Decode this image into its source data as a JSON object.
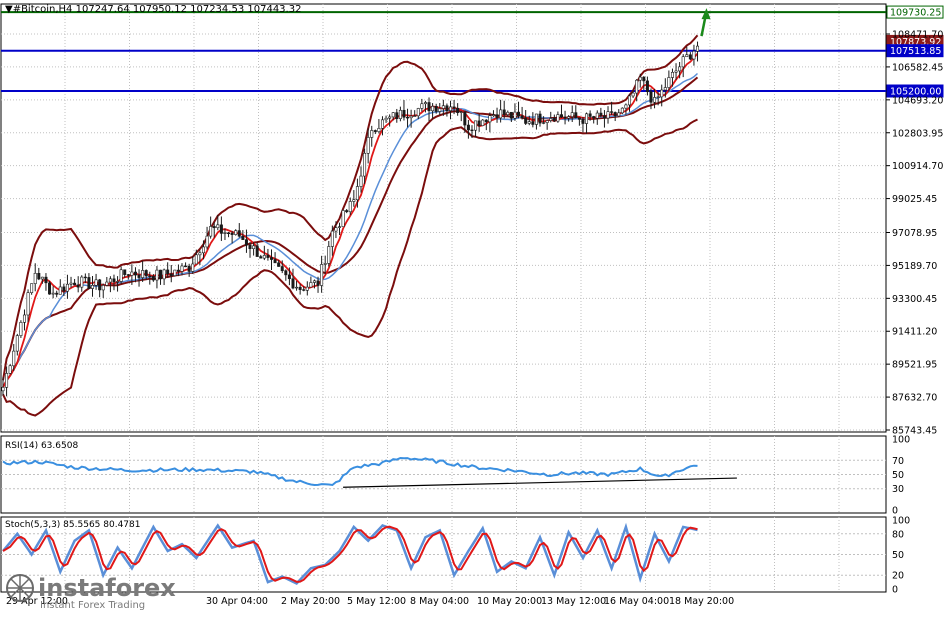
{
  "header": {
    "symbol_line": "▼#Bitcoin,H4  107247.64 107950.12 107234.53 107443.32"
  },
  "colors": {
    "background": "#ffffff",
    "grid": "#c0c0c0",
    "bull_candle": "#1a1a1a",
    "bear_candle": "#1a1a1a",
    "bollinger": "#7b0d0d",
    "ma_fast": "#e01818",
    "ma_slow": "#5a8fd8",
    "level_blue": "#0000c8",
    "level_green": "#006400",
    "rsi_line": "#3a8fe0",
    "stoch_main": "#5a8fd8",
    "stoch_signal": "#e01818",
    "forecast_arrow": "#1a8a1a",
    "trendline": "#000000"
  },
  "watermark": {
    "brand": "instaforex",
    "tagline": "Instant Forex Trading"
  },
  "chart_data": [
    {
      "type": "candlestick",
      "title": "#Bitcoin,H4",
      "ylim": [
        85743.45,
        110800
      ],
      "price_ticks": [
        "108471.70",
        "106582.45",
        "104693.20",
        "102803.95",
        "100914.70",
        "99025.45",
        "97078.95",
        "95189.70",
        "93300.45",
        "91411.20",
        "89521.95",
        "87632.70",
        "85743.45"
      ],
      "time_labels": [
        "29 Apr 12:00",
        "30 Apr 04:00",
        "2 May 20:00",
        "5 May 12:00",
        "8 May 04:00",
        "10 May 20:00",
        "13 May 12:00",
        "16 May 04:00",
        "18 May 20:00"
      ],
      "levels": [
        {
          "label": "109730.25",
          "value": 109730.25,
          "color": "green"
        },
        {
          "label": "107873.92",
          "value": 107873.92,
          "color": "current"
        },
        {
          "label": "107513.85",
          "value": 107513.85,
          "color": "blue"
        },
        {
          "label": "105200.00",
          "value": 105200.0,
          "color": "blue"
        }
      ],
      "anchors": [
        {
          "t": 0,
          "p": 88200
        },
        {
          "t": 4,
          "p": 91200
        },
        {
          "t": 9,
          "p": 94800
        },
        {
          "t": 14,
          "p": 93600
        },
        {
          "t": 20,
          "p": 94300
        },
        {
          "t": 27,
          "p": 94000
        },
        {
          "t": 35,
          "p": 94800
        },
        {
          "t": 44,
          "p": 94600
        },
        {
          "t": 52,
          "p": 95100
        },
        {
          "t": 58,
          "p": 97300
        },
        {
          "t": 66,
          "p": 96900
        },
        {
          "t": 75,
          "p": 95200
        },
        {
          "t": 83,
          "p": 93900
        },
        {
          "t": 88,
          "p": 94200
        },
        {
          "t": 92,
          "p": 97100
        },
        {
          "t": 98,
          "p": 98900
        },
        {
          "t": 103,
          "p": 103100
        },
        {
          "t": 110,
          "p": 103800
        },
        {
          "t": 118,
          "p": 104300
        },
        {
          "t": 126,
          "p": 104400
        },
        {
          "t": 130,
          "p": 103200
        },
        {
          "t": 138,
          "p": 104000
        },
        {
          "t": 146,
          "p": 103500
        },
        {
          "t": 154,
          "p": 103800
        },
        {
          "t": 162,
          "p": 103600
        },
        {
          "t": 170,
          "p": 103700
        },
        {
          "t": 174,
          "p": 104200
        },
        {
          "t": 178,
          "p": 105900
        },
        {
          "t": 182,
          "p": 104500
        },
        {
          "t": 186,
          "p": 105800
        },
        {
          "t": 190,
          "p": 106900
        },
        {
          "t": 194,
          "p": 107800
        }
      ],
      "bars_total": 195
    },
    {
      "type": "line",
      "title": "RSI(14) 63.6508",
      "ylim": [
        0,
        100
      ],
      "ticks": [
        "100",
        "70",
        "50",
        "30",
        "0"
      ],
      "anchors": [
        {
          "t": 0,
          "v": 66
        },
        {
          "t": 10,
          "v": 68
        },
        {
          "t": 20,
          "v": 60
        },
        {
          "t": 35,
          "v": 56
        },
        {
          "t": 55,
          "v": 57
        },
        {
          "t": 70,
          "v": 54
        },
        {
          "t": 82,
          "v": 40
        },
        {
          "t": 92,
          "v": 34
        },
        {
          "t": 98,
          "v": 60
        },
        {
          "t": 106,
          "v": 66
        },
        {
          "t": 112,
          "v": 74
        },
        {
          "t": 122,
          "v": 68
        },
        {
          "t": 132,
          "v": 60
        },
        {
          "t": 142,
          "v": 56
        },
        {
          "t": 152,
          "v": 50
        },
        {
          "t": 160,
          "v": 52
        },
        {
          "t": 170,
          "v": 50
        },
        {
          "t": 178,
          "v": 58
        },
        {
          "t": 184,
          "v": 46
        },
        {
          "t": 190,
          "v": 58
        },
        {
          "t": 194,
          "v": 63.6508
        }
      ],
      "trendline": {
        "t0": 95,
        "v0": 32,
        "t1": 205,
        "v1": 45
      }
    },
    {
      "type": "line",
      "title": "Stoch(5,3,3) 85.5565 80.4781",
      "ylim": [
        0,
        100
      ],
      "ticks": [
        "100",
        "80",
        "50",
        "20",
        "0"
      ],
      "anchors": [
        {
          "t": 0,
          "v": 55
        },
        {
          "t": 4,
          "v": 80
        },
        {
          "t": 8,
          "v": 50
        },
        {
          "t": 12,
          "v": 85
        },
        {
          "t": 16,
          "v": 25
        },
        {
          "t": 20,
          "v": 70
        },
        {
          "t": 24,
          "v": 85
        },
        {
          "t": 28,
          "v": 20
        },
        {
          "t": 32,
          "v": 60
        },
        {
          "t": 36,
          "v": 30
        },
        {
          "t": 42,
          "v": 90
        },
        {
          "t": 46,
          "v": 55
        },
        {
          "t": 50,
          "v": 65
        },
        {
          "t": 54,
          "v": 45
        },
        {
          "t": 60,
          "v": 92
        },
        {
          "t": 64,
          "v": 60
        },
        {
          "t": 70,
          "v": 70
        },
        {
          "t": 74,
          "v": 10
        },
        {
          "t": 78,
          "v": 18
        },
        {
          "t": 82,
          "v": 8
        },
        {
          "t": 86,
          "v": 30
        },
        {
          "t": 90,
          "v": 35
        },
        {
          "t": 94,
          "v": 55
        },
        {
          "t": 98,
          "v": 90
        },
        {
          "t": 102,
          "v": 70
        },
        {
          "t": 106,
          "v": 92
        },
        {
          "t": 110,
          "v": 85
        },
        {
          "t": 114,
          "v": 30
        },
        {
          "t": 118,
          "v": 75
        },
        {
          "t": 122,
          "v": 85
        },
        {
          "t": 126,
          "v": 20
        },
        {
          "t": 130,
          "v": 55
        },
        {
          "t": 134,
          "v": 88
        },
        {
          "t": 138,
          "v": 25
        },
        {
          "t": 142,
          "v": 40
        },
        {
          "t": 146,
          "v": 30
        },
        {
          "t": 150,
          "v": 75
        },
        {
          "t": 154,
          "v": 20
        },
        {
          "t": 158,
          "v": 82
        },
        {
          "t": 162,
          "v": 45
        },
        {
          "t": 166,
          "v": 85
        },
        {
          "t": 170,
          "v": 30
        },
        {
          "t": 174,
          "v": 90
        },
        {
          "t": 178,
          "v": 15
        },
        {
          "t": 182,
          "v": 80
        },
        {
          "t": 186,
          "v": 40
        },
        {
          "t": 190,
          "v": 90
        },
        {
          "t": 194,
          "v": 85.5565
        }
      ],
      "signal_value": 80.4781
    }
  ]
}
